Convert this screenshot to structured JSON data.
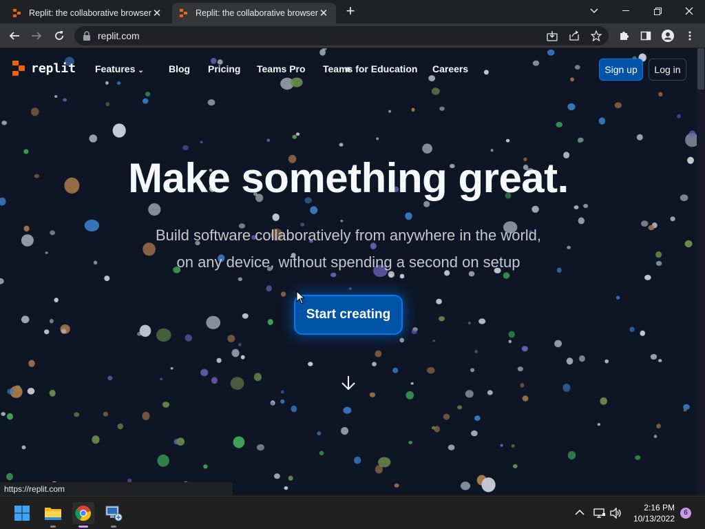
{
  "browser": {
    "tabs": [
      {
        "title": "Replit: the collaborative browser",
        "active": false
      },
      {
        "title": "Replit: the collaborative browser",
        "active": true
      }
    ],
    "url": "replit.com",
    "status_url": "https://replit.com"
  },
  "site": {
    "logo_text": "replit",
    "nav": {
      "features": "Features",
      "blog": "Blog",
      "pricing": "Pricing",
      "teams_pro": "Teams Pro",
      "teams_edu": "Teams for Education",
      "careers": "Careers",
      "signup": "Sign up",
      "login": "Log in"
    },
    "hero": {
      "title": "Make something great.",
      "subtitle_line1": "Build software collaboratively from anywhere in the world,",
      "subtitle_line2": "on any device, without spending a second on setup",
      "cta": "Start creating"
    },
    "colors": {
      "background": "#0e1525",
      "accent": "#0079f2",
      "brand": "#f26207"
    }
  },
  "taskbar": {
    "time": "2:16 PM",
    "date": "10/13/2022",
    "notification_count": "6"
  }
}
